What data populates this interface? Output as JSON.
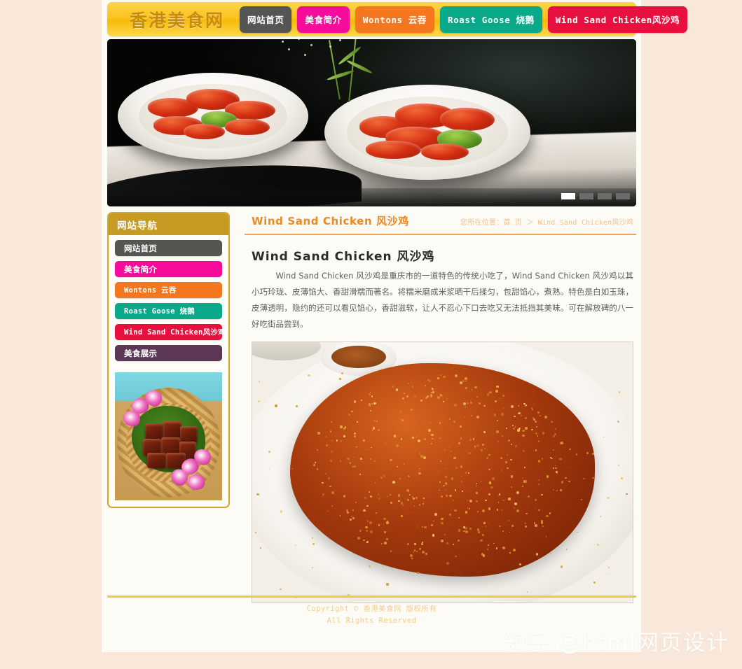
{
  "site": {
    "logo": "香港美食网",
    "background_color": "#f9e8d9",
    "page_color": "#fdfbf6",
    "accent_color": "#e98a22"
  },
  "topnav": {
    "items": [
      {
        "label": "网站首页",
        "color": "#555554"
      },
      {
        "label": "美食简介",
        "color": "#f50c9b"
      },
      {
        "label": "Wontons 云吞",
        "color": "#f4761f"
      },
      {
        "label": "Roast Goose 烧鹅",
        "color": "#0aa98a"
      },
      {
        "label": "Wind Sand Chicken风沙鸡",
        "color": "#e8103f"
      }
    ]
  },
  "banner": {
    "alt": "糖醋里脊 两碗红烧菜肴",
    "slides": [
      {
        "active": true
      },
      {
        "active": false
      },
      {
        "active": false
      },
      {
        "active": false
      }
    ]
  },
  "sidebar": {
    "heading": "网站导航",
    "items": [
      {
        "label": "网站首页",
        "color": "#555554",
        "mono": false
      },
      {
        "label": "美食简介",
        "color": "#f50c9b",
        "mono": false
      },
      {
        "label": "Wontons 云吞",
        "color": "#f4761f",
        "mono": true
      },
      {
        "label": "Roast Goose 烧鹅",
        "color": "#0aa98a",
        "mono": true
      },
      {
        "label": "Wind Sand Chicken风沙鸡",
        "color": "#e8103f",
        "mono": true
      },
      {
        "label": "美食展示",
        "color": "#5d3856",
        "mono": false
      }
    ],
    "photo_alt": "竹篮中的东坡肉配兰花"
  },
  "content": {
    "title": "Wind Sand Chicken 风沙鸡",
    "breadcrumb_prefix": "您所在位置：",
    "breadcrumb_home": "首 页",
    "breadcrumb_sep": "＞",
    "breadcrumb_current": "Wind Sand Chicken风沙鸡",
    "article_title": "Wind Sand Chicken 风沙鸡",
    "article_body": "Wind Sand Chicken 风沙鸡是重庆市的一道特色的传统小吃了，Wind Sand Chicken 风沙鸡以其小巧玲珑、皮薄馅大、香甜滑糯而著名。将糯米磨成米浆晒干后揉匀，包甜馅心，煮熟。特色是白如玉珠，皮薄透明，隐约的还可以看见馅心，香甜滋软，让人不忍心下口去吃又无法抵挡其美味。可在解放碑的八一好吃街品尝到。",
    "article_photo_alt": "白盘上的蒜香风沙鸡"
  },
  "footer": {
    "line1": "Copyright © 香港美食网 版权所有",
    "line2": "All Rights Reserved"
  },
  "watermark": {
    "text": "知乎 @html网页设计"
  }
}
